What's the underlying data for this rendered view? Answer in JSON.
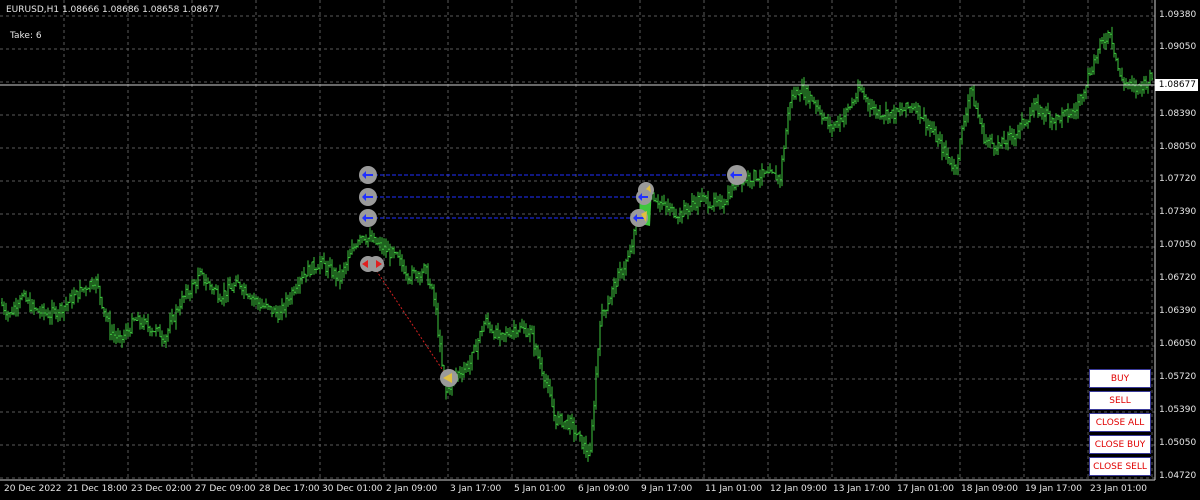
{
  "header": {
    "symbol_line": "EURUSD,H1  1.08666 1.08686 1.08658 1.08677",
    "take_label": "Take: 6"
  },
  "current_price": "1.08677",
  "price_axis": [
    "1.09380",
    "1.09050",
    "1.08390",
    "1.08050",
    "1.07720",
    "1.07390",
    "1.07050",
    "1.06720",
    "1.06390",
    "1.06050",
    "1.05720",
    "1.05390",
    "1.05050",
    "1.04720"
  ],
  "time_axis": [
    "20 Dec 2022",
    "21 Dec 18:00",
    "23 Dec 02:00",
    "27 Dec 09:00",
    "28 Dec 17:00",
    "30 Dec 01:00",
    "2 Jan 09:00",
    "3 Jan 17:00",
    "5 Jan 01:00",
    "6 Jan 09:00",
    "9 Jan 17:00",
    "11 Jan 01:00",
    "12 Jan 09:00",
    "13 Jan 17:00",
    "17 Jan 01:00",
    "18 Jan 09:00",
    "19 Jan 17:00",
    "23 Jan 01:00"
  ],
  "buttons": {
    "buy": "BUY",
    "sell": "SELL",
    "close_all": "CLOSE ALL",
    "close_buy": "CLOSE BUY",
    "close_sell": "CLOSE SELL"
  },
  "colors": {
    "background": "#000000",
    "grid": "#5a5a5a",
    "bars": "#3ec63e",
    "order_line": "#2030ff",
    "trade_line": "#d02020",
    "button_text": "#e00000",
    "marker": "#9a9a9a"
  },
  "chart_data": {
    "type": "bar",
    "symbol": "EURUSD",
    "timeframe": "H1",
    "ohlc_current": {
      "open": 1.08666,
      "high": 1.08686,
      "low": 1.08658,
      "close": 1.08677
    },
    "ylim": [
      1.0457,
      1.0953
    ],
    "grid": true,
    "price_path": [
      [
        0,
        1.064
      ],
      [
        10,
        1.0628
      ],
      [
        20,
        1.0648
      ],
      [
        35,
        1.0632
      ],
      [
        50,
        1.0628
      ],
      [
        65,
        1.0638
      ],
      [
        80,
        1.0652
      ],
      [
        95,
        1.0665
      ],
      [
        110,
        1.0612
      ],
      [
        120,
        1.06
      ],
      [
        135,
        1.0622
      ],
      [
        150,
        1.0615
      ],
      [
        165,
        1.0605
      ],
      [
        180,
        1.064
      ],
      [
        200,
        1.0668
      ],
      [
        220,
        1.0648
      ],
      [
        240,
        1.066
      ],
      [
        260,
        1.0638
      ],
      [
        280,
        1.0628
      ],
      [
        300,
        1.0668
      ],
      [
        320,
        1.0682
      ],
      [
        340,
        1.0665
      ],
      [
        360,
        1.0712
      ],
      [
        375,
        1.0702
      ],
      [
        395,
        1.0688
      ],
      [
        410,
        1.0668
      ],
      [
        425,
        1.0675
      ],
      [
        435,
        1.064
      ],
      [
        445,
        1.0545
      ],
      [
        455,
        1.0565
      ],
      [
        470,
        1.0578
      ],
      [
        485,
        1.0622
      ],
      [
        500,
        1.0602
      ],
      [
        515,
        1.0615
      ],
      [
        530,
        1.061
      ],
      [
        545,
        1.0562
      ],
      [
        555,
        1.052
      ],
      [
        570,
        1.0515
      ],
      [
        580,
        1.0498
      ],
      [
        590,
        1.0482
      ],
      [
        600,
        1.0622
      ],
      [
        615,
        1.066
      ],
      [
        630,
        1.069
      ],
      [
        640,
        1.074
      ],
      [
        650,
        1.0755
      ],
      [
        665,
        1.0738
      ],
      [
        680,
        1.0732
      ],
      [
        700,
        1.0748
      ],
      [
        720,
        1.074
      ],
      [
        738,
        1.0768
      ],
      [
        760,
        1.0772
      ],
      [
        780,
        1.077
      ],
      [
        790,
        1.085
      ],
      [
        800,
        1.0862
      ],
      [
        815,
        1.0848
      ],
      [
        830,
        1.082
      ],
      [
        845,
        1.0835
      ],
      [
        860,
        1.086
      ],
      [
        875,
        1.0838
      ],
      [
        895,
        1.0835
      ],
      [
        915,
        1.0845
      ],
      [
        935,
        1.0812
      ],
      [
        955,
        1.0778
      ],
      [
        970,
        1.0862
      ],
      [
        985,
        1.0808
      ],
      [
        1000,
        1.0802
      ],
      [
        1015,
        1.0815
      ],
      [
        1035,
        1.0842
      ],
      [
        1055,
        1.083
      ],
      [
        1075,
        1.0838
      ],
      [
        1090,
        1.088
      ],
      [
        1100,
        1.0905
      ],
      [
        1110,
        1.0922
      ],
      [
        1120,
        1.0872
      ],
      [
        1135,
        1.086
      ],
      [
        1150,
        1.0872
      ]
    ]
  }
}
